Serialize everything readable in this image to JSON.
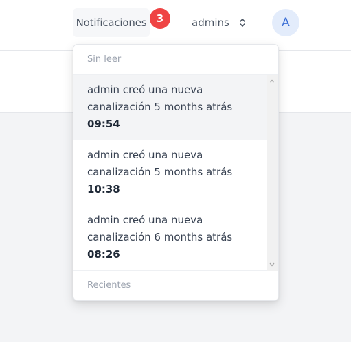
{
  "header": {
    "notifications_label": "Notificaciones",
    "notifications_count": "3",
    "user_name": "admins",
    "avatar_initial": "A"
  },
  "dropdown": {
    "unread_header": "Sin leer",
    "items": [
      {
        "text": "admin creó una nueva canalización 5 months atrás",
        "time": "09:54"
      },
      {
        "text": "admin creó una nueva canalización 5 months atrás",
        "time": "10:38"
      },
      {
        "text": "admin creó una nueva canalización 6 months atrás",
        "time": "08:26"
      }
    ],
    "recent_header": "Recientes"
  },
  "icons": {
    "updown": "chevron-up-down-icon",
    "scroll_up": "scroll-up-arrow-icon",
    "scroll_down": "scroll-down-arrow-icon"
  },
  "colors": {
    "badge": "#ef4444",
    "avatar_bg": "#e3ecfb",
    "avatar_text": "#3b6fd6",
    "active_item_bg": "#f3f4f6"
  }
}
